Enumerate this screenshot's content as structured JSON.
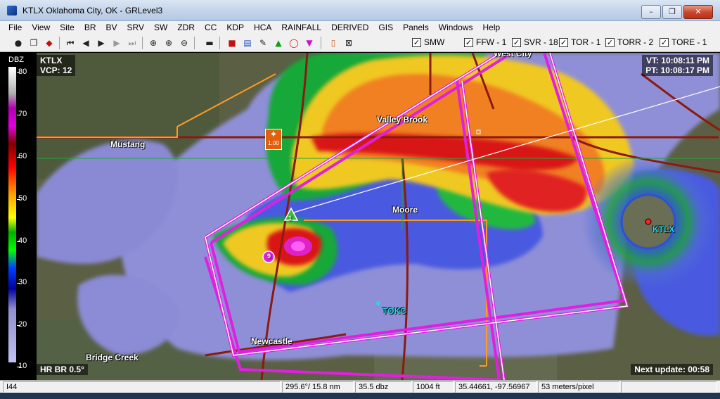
{
  "window": {
    "title": "KTLX Oklahoma City, OK - GRLevel3",
    "controls": [
      "–",
      "❐",
      "✕"
    ]
  },
  "menu": [
    "File",
    "View",
    "Site",
    "BR",
    "BV",
    "SRV",
    "SW",
    "ZDR",
    "CC",
    "KDP",
    "HCA",
    "RAINFALL",
    "DERIVED",
    "GIS",
    "Panels",
    "Windows",
    "Help"
  ],
  "toolbar": {
    "checks": [
      {
        "label": "SMW",
        "checked": true
      },
      {
        "label": "FFW - 1",
        "checked": true
      },
      {
        "label": "SVR - 18",
        "checked": true
      },
      {
        "label": "TOR - 1",
        "checked": true
      },
      {
        "label": "TORR - 2",
        "checked": true
      },
      {
        "label": "TORE - 1",
        "checked": true
      }
    ]
  },
  "colorbar": {
    "unit": "DBZ",
    "ticks": [
      "80",
      "70",
      "60",
      "50",
      "40",
      "30",
      "20",
      "10"
    ]
  },
  "map": {
    "site": "KTLX",
    "vcp": "VCP: 12",
    "vt": "VT: 10:08:11 PM",
    "pt": "PT: 10:08:17 PM",
    "product": "HR BR 0.5°",
    "next_update": "Next update: 00:58",
    "places": {
      "mustang": "Mustang",
      "valley_brook": "Valley Brook",
      "moore": "Moore",
      "tokc": "TOKC",
      "newcastle": "Newcastle",
      "bridge_creek": "Bridge Creek",
      "ktlx": "KTLX",
      "west_city": "West City"
    },
    "markers": {
      "storm_marker": "1.00",
      "meso_id": "1",
      "tvs_id": "9"
    },
    "colors": {
      "warning_outline": "#e020e0",
      "highway": "#8b1a10",
      "county": "#ff9a20"
    }
  },
  "status": {
    "cells": [
      "I44",
      "295.6°/ 15.8 nm",
      "35.5 dbz",
      "1004 ft",
      "35.44661, -97.56967",
      "53 meters/pixel",
      ""
    ]
  }
}
